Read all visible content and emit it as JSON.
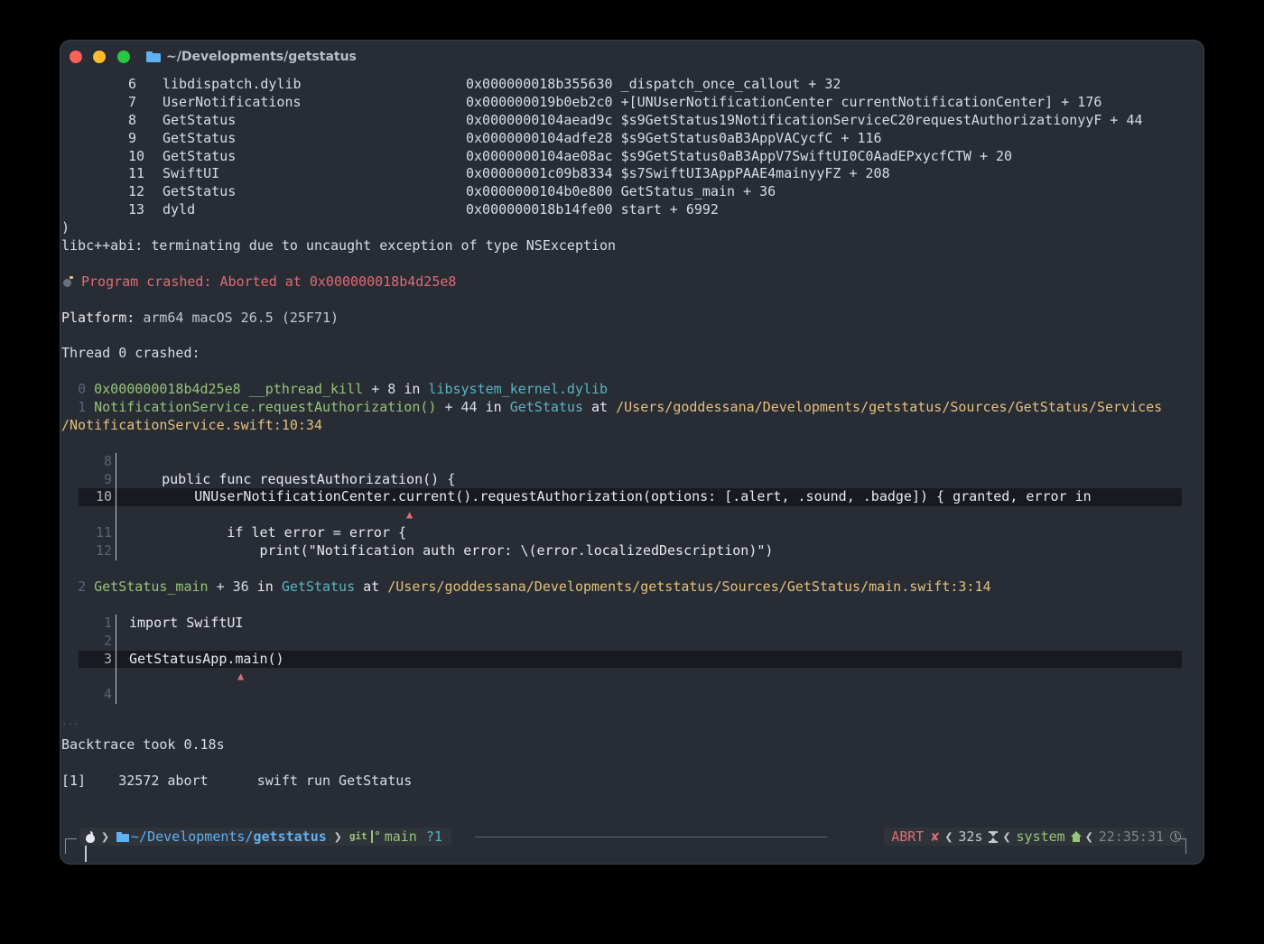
{
  "window": {
    "title": "~/Developments/getstatus",
    "traffic_lights": {
      "close": "#ff5f57",
      "minimize": "#febc2e",
      "zoom": "#28c840"
    }
  },
  "backtrace": [
    {
      "num": "6",
      "lib": "libdispatch.dylib",
      "addr": "0x000000018b355630 _dispatch_once_callout + 32"
    },
    {
      "num": "7",
      "lib": "UserNotifications",
      "addr": "0x000000019b0eb2c0 +[UNUserNotificationCenter currentNotificationCenter] + 176"
    },
    {
      "num": "8",
      "lib": "GetStatus",
      "addr": "0x0000000104aead9c $s9GetStatus19NotificationServiceC20requestAuthorizationyyF + 44"
    },
    {
      "num": "9",
      "lib": "GetStatus",
      "addr": "0x0000000104adfe28 $s9GetStatus0aB3AppVACycfC + 116"
    },
    {
      "num": "10",
      "lib": "GetStatus",
      "addr": "0x0000000104ae08ac $s9GetStatus0aB3AppV7SwiftUI0C0AadEPxycfCTW + 20"
    },
    {
      "num": "11",
      "lib": "SwiftUI",
      "addr": "0x00000001c09b8334 $s7SwiftUI3AppPAAE4mainyyFZ + 208"
    },
    {
      "num": "12",
      "lib": "GetStatus",
      "addr": "0x0000000104b0e800 GetStatus_main + 36"
    },
    {
      "num": "13",
      "lib": "dyld",
      "addr": "0x000000018b14fe00 start + 6992"
    }
  ],
  "close_paren": ")",
  "libcxx_msg": "libc++abi: terminating due to uncaught exception of type NSException",
  "crash": {
    "icon": "bomb-icon",
    "message": "Program crashed: Aborted at 0x000000018b4d25e8"
  },
  "platform": {
    "label": "Platform:",
    "value": "arm64 macOS 26.5 (25F71)"
  },
  "thread_header": "Thread 0 crashed:",
  "frame0": {
    "idx": "0",
    "addr": "0x000000018b4d25e8",
    "sym": "__pthread_kill",
    "offset": "+ 8",
    "in": "in",
    "lib": "libsystem_kernel.dylib"
  },
  "frame1": {
    "idx": "1",
    "sym": "NotificationService.requestAuthorization()",
    "offset": "+ 44",
    "in": "in",
    "lib": "GetStatus",
    "at": "at",
    "path1": "/Users/goddessana/Developments/getstatus/Sources/GetStatus/Services",
    "path2": "/NotificationService.swift:10:34"
  },
  "code1": [
    {
      "ln": "8",
      "src": ""
    },
    {
      "ln": "9",
      "src": "    public func requestAuthorization() {"
    },
    {
      "ln": "10",
      "src": "        UNUserNotificationCenter.current().requestAuthorization(options: [.alert, .sound, .badge]) { granted, error in"
    },
    {
      "ln": "11",
      "src": "            if let error = error {"
    },
    {
      "ln": "12",
      "src": "                print(\"Notification auth error: \\(error.localizedDescription)\")"
    }
  ],
  "frame2": {
    "idx": "2",
    "sym": "GetStatus_main",
    "offset": "+ 36",
    "in": "in",
    "lib": "GetStatus",
    "at": "at",
    "path": "/Users/goddessana/Developments/getstatus/Sources/GetStatus/main.swift:3:14"
  },
  "code2": [
    {
      "ln": "1",
      "src": "import SwiftUI"
    },
    {
      "ln": "2",
      "src": ""
    },
    {
      "ln": "3",
      "src": "GetStatusApp.main()"
    },
    {
      "ln": "4",
      "src": ""
    }
  ],
  "caret": "▲",
  "ellipsis": "...",
  "backtrace_took": "Backtrace took 0.18s",
  "job": {
    "id": "[1]",
    "pid": "32572",
    "state": "abort",
    "cmd": "swift run GetStatus"
  },
  "prompt": {
    "os_icon": "apple-icon",
    "sep": "❯",
    "dir_prefix": "~/Developments/",
    "dir_name": "getstatus",
    "vcs": "git",
    "branch": "main",
    "status": "?1",
    "exit": "ABRT",
    "exit_mark": "✘",
    "duration": "32s",
    "duration_icon": "hourglass-icon",
    "env": "system",
    "env_icon": "home-icon",
    "time": "22:35:31",
    "time_icon": "clock-icon",
    "rsep": "❮"
  }
}
